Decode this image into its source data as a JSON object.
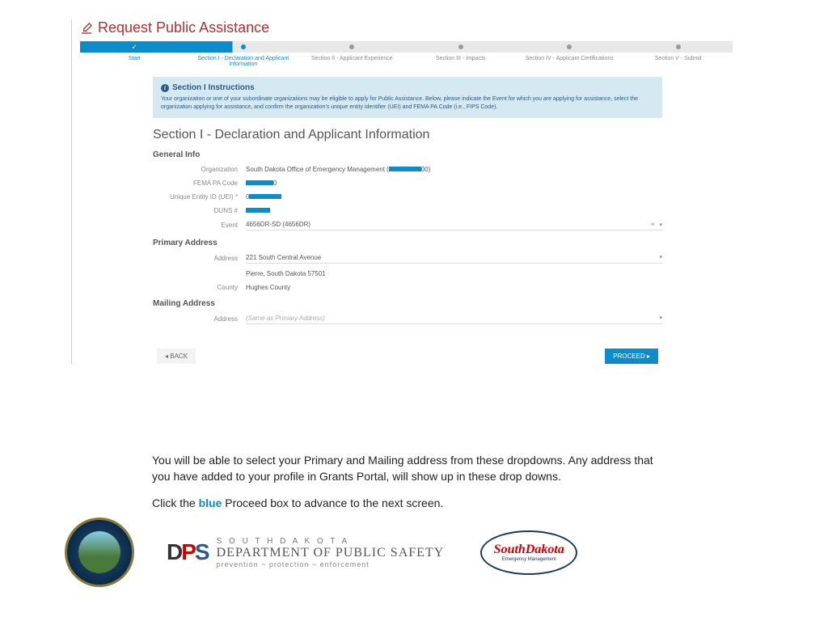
{
  "header": {
    "title": "Request Public Assistance"
  },
  "steps": {
    "s0": "Start",
    "s1": "Section I - Declaration and Applicant Information",
    "s2": "Section II - Applicant Experience",
    "s3": "Section III - Impacts",
    "s4": "Section IV - Applicant Certifications",
    "s5": "Section V - Submit"
  },
  "instructions": {
    "title": "Section I Instructions",
    "body": "Your organization or one of your subordinate organizations may be eligible to apply for Public Assistance. Below, please indicate the Event for which you are applying for assistance, select the organization applying for assistance, and confirm the organization's unique entity identifier (UEI) and FEMA PA Code (i.e., FIPS Code)."
  },
  "section": {
    "heading": "Section I - Declaration and Applicant Information",
    "general_info": "General Info",
    "primary_addr": "Primary Address",
    "mailing_addr": "Mailing Address"
  },
  "fields": {
    "org_label": "Organization",
    "org_value": "South Dakota Office of Emergency Management (",
    "org_suffix": "00)",
    "pa_label": "FEMA PA Code",
    "pa_suffix": "0",
    "uei_label": "Unique Entity ID (UEI) *",
    "uei_prefix": "0",
    "duns_label": "DUNS #",
    "event_label": "Event",
    "event_value": "4656DR-SD (4656DR)",
    "addr_label": "Address",
    "addr_value": "221 South Central Avenue",
    "addr_city": "Pierre, South Dakota 57501",
    "county_label": "County",
    "county_value": "Hughes County",
    "mail_addr_label": "Address",
    "mail_placeholder": "(Same as Primary Address)"
  },
  "buttons": {
    "back": "◂ BACK",
    "proceed": "PROCEED ▸"
  },
  "help": {
    "p1": "You will be able to select your Primary and Mailing address from these dropdowns. Any address that you have added to your profile in Grants Portal, will show up in these drop downs.",
    "p2a": "Click the ",
    "p2b": "blue",
    "p2c": " Proceed box to advance to the next screen."
  },
  "logos": {
    "dps_sd": "S O U T H   D A K O T A",
    "dps_main": "DEPARTMENT OF PUBLIC SAFETY",
    "dps_tag": "prevention ~ protection ~ enforcement",
    "oem_script": "SouthDakota",
    "oem_sub": "Emergency Management"
  }
}
